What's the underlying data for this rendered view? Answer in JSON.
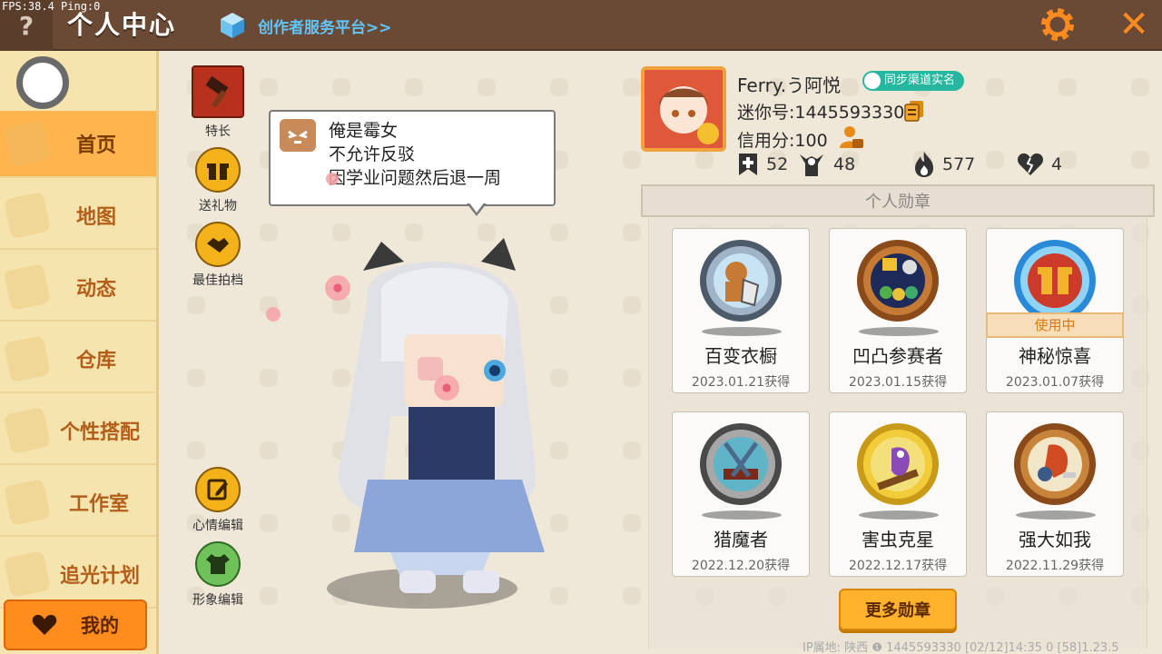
{
  "debug": {
    "fps": "FPS:38.4  Ping:0"
  },
  "header": {
    "help_label": "?",
    "title": "个人中心",
    "creator_link": "创作者服务平台>>",
    "close_label": "✕"
  },
  "sidebar": {
    "items": [
      {
        "label": "首页",
        "active": true
      },
      {
        "label": "地图"
      },
      {
        "label": "动态"
      },
      {
        "label": "仓库"
      },
      {
        "label": "个性搭配"
      },
      {
        "label": "工作室"
      },
      {
        "label": "追光计划"
      }
    ],
    "me_label": "我的"
  },
  "actions": {
    "specialty": "特长",
    "send_gift": "送礼物",
    "best_partner": "最佳拍档",
    "mood_edit": "心情编辑",
    "look_edit": "形象编辑"
  },
  "speech": {
    "lines": [
      "俺是霉女",
      "不允许反驳",
      "因学业问题然后退一周"
    ]
  },
  "profile": {
    "nickname": "Ferry.う阿悦",
    "verify_badge": "同步渠道实名",
    "mini_id": "迷你号:1445593330",
    "credit": "信用分:100",
    "stats": {
      "likes": "52",
      "fans": "48",
      "heat": "577",
      "hearts": "4"
    }
  },
  "medals": {
    "title": "个人勋章",
    "in_use_label": "使用中",
    "items": [
      {
        "name": "百变衣橱",
        "date": "2023.01.21获得"
      },
      {
        "name": "凹凸参赛者",
        "date": "2023.01.15获得"
      },
      {
        "name": "神秘惊喜",
        "date": "2023.01.07获得",
        "in_use": true
      },
      {
        "name": "猎魔者",
        "date": "2022.12.20获得"
      },
      {
        "name": "害虫克星",
        "date": "2022.12.17获得"
      },
      {
        "name": "强大如我",
        "date": "2022.11.29获得"
      }
    ],
    "more_button": "更多勋章"
  },
  "footer": {
    "info": "IP属地: 陕西 ❶      1445593330    [02/12]14:35 0   [58]1.23.5"
  },
  "colors": {
    "header_bg": "#6b4a35",
    "accent_orange": "#ff8d1e",
    "sidebar_bg": "#f6e4ae",
    "link_blue": "#5fc7ff",
    "badge_teal": "#25b7a0"
  }
}
